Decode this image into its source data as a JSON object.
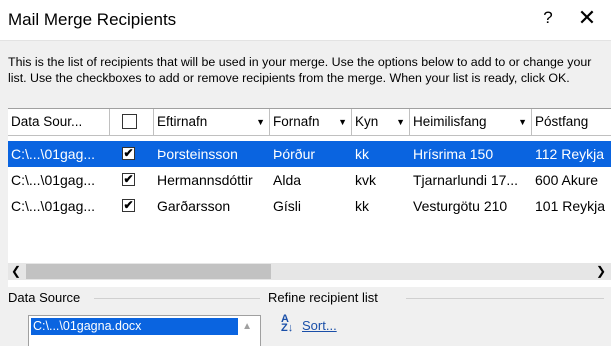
{
  "window": {
    "title": "Mail Merge Recipients",
    "help": "?",
    "close": "✕"
  },
  "description": "This is the list of recipients that will be used in your merge.  Use the options below to add to or change your list.  Use the checkboxes to add or remove recipients from the merge.  When your list is ready, click OK.",
  "table": {
    "columns": [
      "Data Sour...",
      "",
      "Eftirnafn",
      "Fornafn",
      "Kyn",
      "Heimilisfang",
      "Póstfang"
    ],
    "rows": [
      {
        "source": "C:\\...\\01gag...",
        "checked": "✔",
        "last": "Þorsteinsson",
        "first": "Þórður",
        "gender": "kk",
        "address": "Hrísrima 150",
        "postal": "112 Reykja"
      },
      {
        "source": "C:\\...\\01gag...",
        "checked": "✔",
        "last": "Hermannsdóttir",
        "first": "Alda",
        "gender": "kvk",
        "address": "Tjarnarlundi 17...",
        "postal": "600 Akure"
      },
      {
        "source": "C:\\...\\01gag...",
        "checked": "✔",
        "last": "Garðarsson",
        "first": "Gísli",
        "gender": "kk",
        "address": "Vesturgötu 210",
        "postal": "101 Reykja"
      }
    ]
  },
  "data_source": {
    "label": "Data Source",
    "item": "C:\\...\\01gagna.docx"
  },
  "refine": {
    "label": "Refine recipient list",
    "sort": "Sort...",
    "sort_icon": "A↓Z"
  },
  "colors": {
    "selection": "#0a64e0",
    "link": "#1a4fa8"
  }
}
